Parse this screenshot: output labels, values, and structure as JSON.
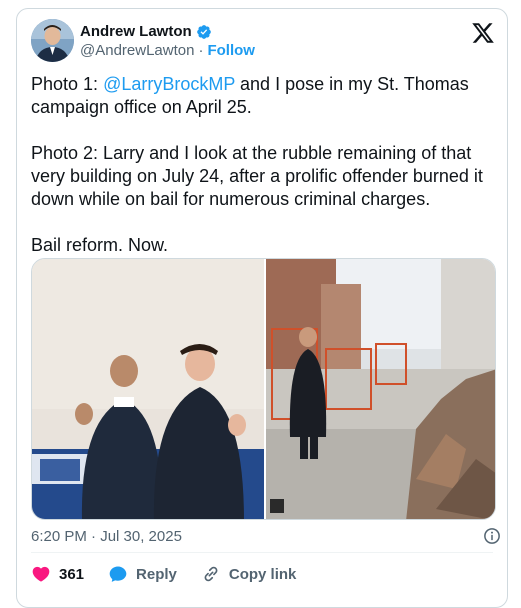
{
  "author": {
    "name": "Andrew Lawton",
    "handle": "@AndrewLawton",
    "separator": "·",
    "follow_label": "Follow"
  },
  "tweet": {
    "p1_prefix": "Photo 1: ",
    "p1_mention": "@LarryBrockMP",
    "p1_suffix": " and I pose in my St. Thomas campaign office on April 25.",
    "p2": "Photo 2: Larry and I look at the rubble remaining of that very building on July 24, after a prolific offender burned it down while on bail for numerous criminal charges.",
    "p3": "Bail reform. Now."
  },
  "timestamp": "6:20 PM · Jul 30, 2025",
  "actions": {
    "like_count": "361",
    "reply_label": "Reply",
    "copy_link_label": "Copy link"
  },
  "colors": {
    "accent": "#1d9bf0",
    "like": "#f91880",
    "secondary_text": "#536471"
  },
  "icons": [
    "verified-badge-icon",
    "x-logo-icon",
    "info-icon",
    "heart-icon",
    "reply-icon",
    "link-icon"
  ]
}
